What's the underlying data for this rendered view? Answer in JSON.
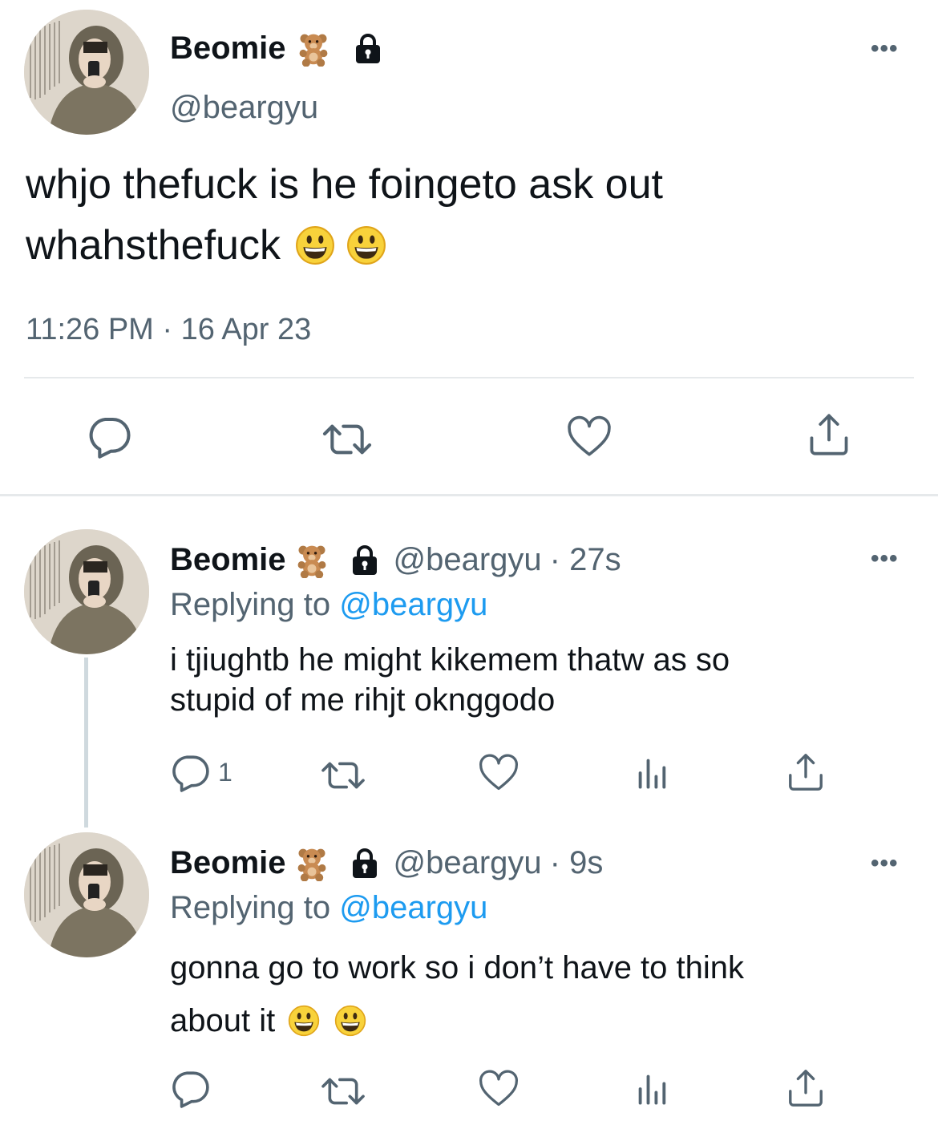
{
  "main_tweet": {
    "display_name": "Beomie",
    "name_emoji": "teddy-bear-emoji",
    "handle": "@beargyu",
    "text_line1": "whjo thefuck is he foingeto ask out",
    "text_line2": "whahsthefuck",
    "timestamp": "11:26 PM · 16 Apr 23"
  },
  "replies": [
    {
      "display_name": "Beomie",
      "handle": "@beargyu",
      "time": "· 27s",
      "replying_prefix": "Replying to",
      "replying_to": "@beargyu",
      "text_line1": "i tjiughtb he might kikemem thatw as so",
      "text_line2": "stupid of me rihjt oknggodo",
      "reply_count": "1"
    },
    {
      "display_name": "Beomie",
      "handle": "@beargyu",
      "time": "· 9s",
      "replying_prefix": "Replying to",
      "replying_to": "@beargyu",
      "text_line1": "gonna go to work so i don’t have to think",
      "text_line2": "about it",
      "reply_count": ""
    }
  ],
  "colors": {
    "text": "#0f1419",
    "muted": "#536471",
    "link": "#1d9bf0",
    "divider": "#e6e9eb"
  }
}
